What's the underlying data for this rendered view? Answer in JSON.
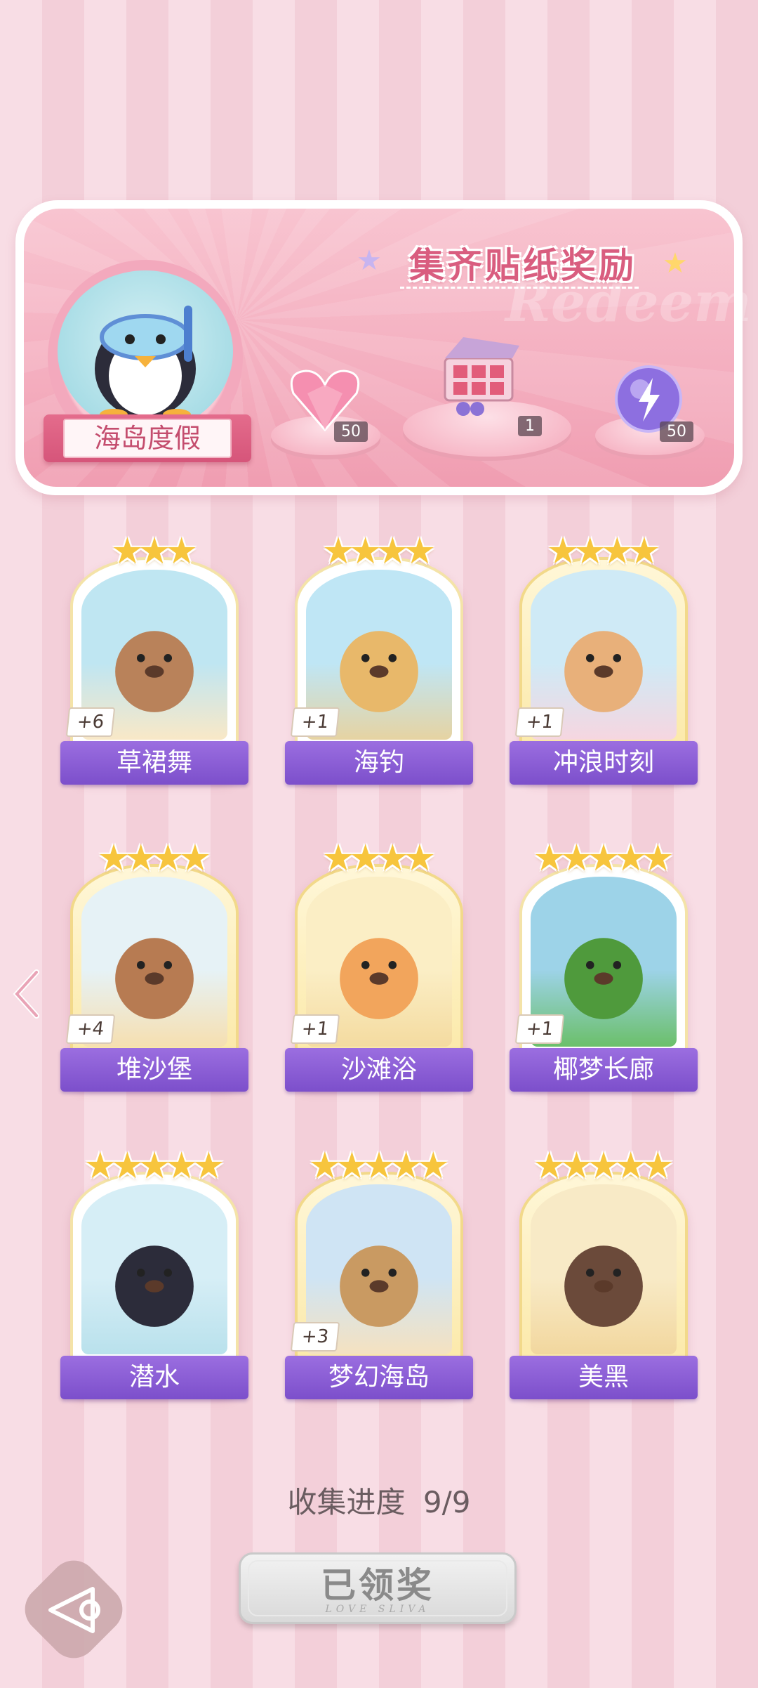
{
  "banner": {
    "title": "集齐贴纸奖励",
    "watermark": "Redeem",
    "avatar_label": "海岛度假",
    "rewards": [
      {
        "icon": "pink-heart-gem-icon",
        "count": "50"
      },
      {
        "icon": "gift-box-icon",
        "count": "1"
      },
      {
        "icon": "purple-energy-orb-icon",
        "count": "50"
      }
    ]
  },
  "cards": [
    {
      "label": "草裙舞",
      "badge": "+6",
      "stars": 3,
      "gold": false
    },
    {
      "label": "海钓",
      "badge": "+1",
      "stars": 4,
      "gold": false
    },
    {
      "label": "冲浪时刻",
      "badge": "+1",
      "stars": 4,
      "gold": true
    },
    {
      "label": "堆沙堡",
      "badge": "+4",
      "stars": 4,
      "gold": true
    },
    {
      "label": "沙滩浴",
      "badge": "+1",
      "stars": 4,
      "gold": true
    },
    {
      "label": "椰梦长廊",
      "badge": "+1",
      "stars": 5,
      "gold": false
    },
    {
      "label": "潜水",
      "badge": "",
      "stars": 5,
      "gold": false
    },
    {
      "label": "梦幻海岛",
      "badge": "+3",
      "stars": 5,
      "gold": true
    },
    {
      "label": "美黑",
      "badge": "",
      "stars": 5,
      "gold": true
    }
  ],
  "progress": {
    "label": "收集进度",
    "value": "9/9"
  },
  "claim_button": {
    "label": "已领奖",
    "sub": "LOVE SLIVA"
  },
  "colors": {
    "accent": "#7c4fcb",
    "pink": "#f4aebf",
    "star": "#f7c53d"
  }
}
